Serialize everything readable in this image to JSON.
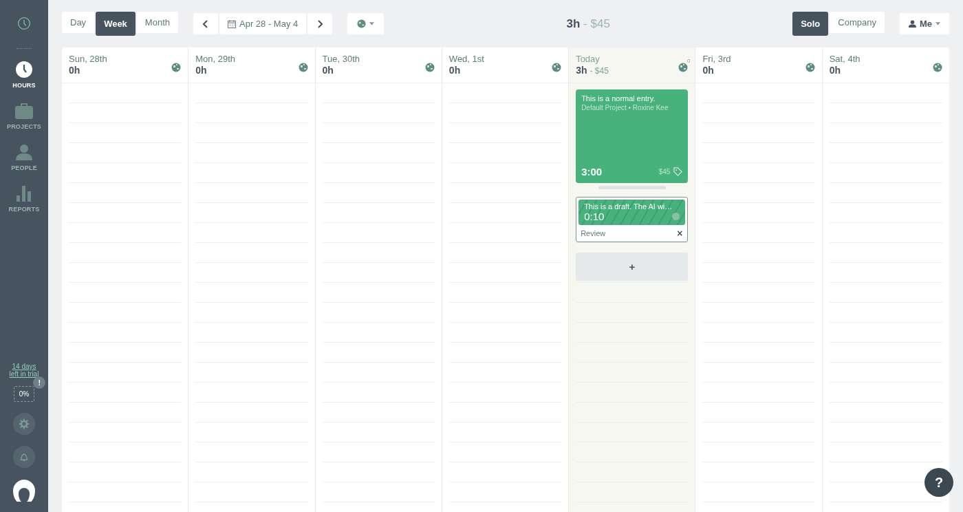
{
  "sidebar": {
    "nav": [
      {
        "label": "HOURS",
        "selected": true
      },
      {
        "label": "PROJECTS",
        "selected": false
      },
      {
        "label": "PEOPLE",
        "selected": false
      },
      {
        "label": "REPORTS",
        "selected": false
      }
    ],
    "trial": "14 days left in trial",
    "progress": "0%",
    "progress_badge": "!"
  },
  "toolbar": {
    "views": [
      {
        "label": "Day",
        "selected": false
      },
      {
        "label": "Week",
        "selected": true
      },
      {
        "label": "Month",
        "selected": false
      }
    ],
    "date_range": "Apr 28 - May 4",
    "total_hours": "3h",
    "total_amount": "- $45",
    "scopes": [
      {
        "label": "Solo",
        "selected": true
      },
      {
        "label": "Company",
        "selected": false
      }
    ],
    "user": "Me"
  },
  "days": [
    {
      "label": "Sun, 28th",
      "hours": "0h",
      "today": false
    },
    {
      "label": "Mon, 29th",
      "hours": "0h",
      "today": false
    },
    {
      "label": "Tue, 30th",
      "hours": "0h",
      "today": false
    },
    {
      "label": "Wed, 1st",
      "hours": "0h",
      "today": false
    },
    {
      "label": "Today",
      "hours": "3h",
      "amount": "- $45",
      "icon_count": "0",
      "today": true,
      "add_label": "+",
      "entries": [
        {
          "kind": "normal",
          "title": "This is a normal entry.",
          "meta": "Default Project • Roxine Kee",
          "duration": "3:00",
          "amount": "$45"
        },
        {
          "kind": "draft",
          "title": "This is a draft. The AI wi…",
          "duration": "0:10",
          "action": "Review",
          "dismiss": "×"
        }
      ]
    },
    {
      "label": "Fri, 3rd",
      "hours": "0h",
      "today": false
    },
    {
      "label": "Sat, 4th",
      "hours": "0h",
      "today": false
    }
  ],
  "help": "?"
}
